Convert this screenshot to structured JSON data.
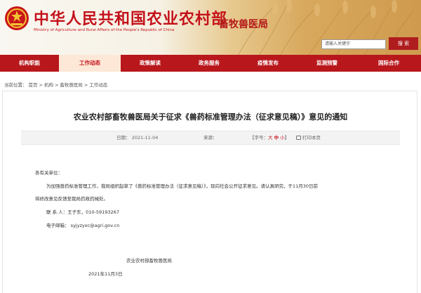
{
  "site": {
    "title": "中华人民共和国农业农村部",
    "subtitle": "Ministry of Agriculture and Rural Affairs of the People's Republic of China",
    "bureau": "畜牧兽医局",
    "colors": {
      "brand_red": "#c4121b",
      "nav_red": "#b8171c",
      "active_tab_bg": "#fde7d6"
    }
  },
  "search": {
    "placeholder": "请输入关键字",
    "button_label": "搜 索"
  },
  "nav": {
    "items": [
      {
        "label": "机构职能"
      },
      {
        "label": "工作动态",
        "active": true
      },
      {
        "label": "政策解读"
      },
      {
        "label": "政务服务"
      },
      {
        "label": "疫情发布"
      },
      {
        "label": "监测预警"
      },
      {
        "label": "国际合作"
      }
    ]
  },
  "breadcrumb": {
    "prefix": "当前位置：",
    "items": [
      "首页",
      "机构",
      "畜牧兽医局",
      "工作动态"
    ],
    "separator": ">"
  },
  "article": {
    "title": "农业农村部畜牧兽医局关于征求《兽药标准管理办法（征求意见稿）》意见的通知",
    "date": "日期：  2021-11-04",
    "source": "来源：",
    "font_label_open": "【字号：",
    "font_large": "大",
    "font_medium": "中",
    "font_small": "小",
    "font_label_close": "】",
    "print": "打印本页",
    "greeting": "各有关单位：",
    "para1_line1": "为加强兽药标准管理工作，我局组织起草了《兽药标准管理办法（征求意见稿）》，现向社会公开征求意见。请认真研究，于11月30日前",
    "para1_line2": "将修改意见反馈至我局药政药械处。",
    "contact": "联 系 人：王子东，010-59193267",
    "email": "电子邮箱：  syjyzyxc@agri.gov.cn",
    "signature": "农业农村部畜牧兽医局",
    "sign_date": "2021年11月3日"
  }
}
